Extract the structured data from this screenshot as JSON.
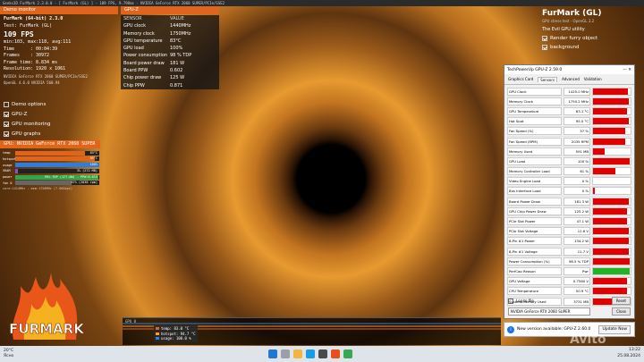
{
  "window_title": "Geeks3D FurMark 2.3.0.0 - [ FurMark (GL) ] - 109 FPS, 9.798ms - NVIDIA GeForce RTX 2060 SUPER/PCIe/SSE2",
  "demo_monitor": "Demo monitor",
  "info": {
    "app": "FurMark (64-bit) 2.3.0",
    "test": "Test: FurMark (GL)",
    "fps": "109 FPS",
    "minmax": "min:103, max:118, avg:111",
    "rows": [
      {
        "k": "Time",
        "v": ": 00:04:39"
      },
      {
        "k": "Frames",
        "v": ": 30972"
      },
      {
        "k": "Frame time",
        "v": ": 8.834 ms"
      },
      {
        "k": "Resolution",
        "v": ": 1920 x 1061"
      }
    ],
    "renderer": "NVIDIA GeForce RTX 2060 SUPER/PCIe/SSE2",
    "opengl": "OpenGL 4.6.0 NVIDIA 560.94"
  },
  "options": [
    {
      "label": "Demo options",
      "checked": false
    },
    {
      "label": "GPU-Z",
      "checked": true
    },
    {
      "label": "GPU monitoring",
      "checked": true
    },
    {
      "label": "GPU graphs",
      "checked": true
    }
  ],
  "gpu_panel": {
    "title": "GPU: NVIDIA GeForce RTX 2060 SUPER",
    "bars": [
      {
        "label": "temp",
        "value": "83°C",
        "fill": 0.83,
        "color": "#e0651a"
      },
      {
        "label": "hotspot",
        "value": "95°C",
        "fill": 0.95,
        "color": "#e0651a"
      },
      {
        "label": "usage",
        "value": "100%",
        "fill": 1.0,
        "color": "#2a7de1"
      },
      {
        "label": "VRAM",
        "value": "3% (272 MB)",
        "fill": 0.03,
        "color": "#8a4bd6"
      },
      {
        "label": "power",
        "value": "99% TDP (177.0W) - PPW:0.615",
        "fill": 0.99,
        "color": "#2aa84a"
      },
      {
        "label": "fan 0",
        "value": "67% (2038 rpm)",
        "fill": 0.67,
        "color": "#666666"
      }
    ],
    "core": "core:1424MHz - mem:1750MHz (7.00Gbps)"
  },
  "gpuz_overlay": {
    "title": "GPU-Z",
    "header": {
      "k": "SENSOR",
      "v": "VALUE"
    },
    "rows": [
      {
        "k": "GPU clock",
        "v": "1440MHz"
      },
      {
        "k": "Memory clock",
        "v": "1750MHz"
      },
      {
        "k": "GPU temperature",
        "v": "83°C"
      },
      {
        "k": "GPU load",
        "v": "100%"
      },
      {
        "k": "Power consumption",
        "v": "98 % TDP"
      },
      {
        "k": "Board power draw",
        "v": "181 W"
      },
      {
        "k": "Board PPW",
        "v": "0.602"
      },
      {
        "k": "Chip power draw",
        "v": "125 W"
      },
      {
        "k": "Chip PPW",
        "v": "0.871"
      }
    ]
  },
  "right_panel": {
    "title": "FurMark (GL)",
    "subtitle": "GPU stress test - OpenGL 3.2",
    "utility": "The Evil GPU utility",
    "options": [
      {
        "label": "Render furry object",
        "checked": true
      },
      {
        "label": "background",
        "checked": true
      }
    ]
  },
  "gpuz_window": {
    "title": "TechPowerUp GPU-Z 2.59.0",
    "tabs": [
      "Graphics Card",
      "Sensors",
      "Advanced",
      "Validation"
    ],
    "active_tab": "Sensors",
    "sensors": [
      {
        "name": "GPU Clock",
        "value": "1425.0 MHz",
        "fill": 0.92,
        "color": "#e00000"
      },
      {
        "name": "Memory Clock",
        "value": "1750.2 MHz",
        "fill": 0.95,
        "color": "#e00000"
      },
      {
        "name": "GPU Temperature",
        "value": "83.1 °C",
        "fill": 0.9,
        "color": "#e00000"
      },
      {
        "name": "Hot Spot",
        "value": "95.0 °C",
        "fill": 0.95,
        "color": "#e00000"
      },
      {
        "name": "Fan Speed (%)",
        "value": "57 %",
        "fill": 0.85,
        "color": "#e00000"
      },
      {
        "name": "Fan Speed (RPM)",
        "value": "2035 RPM",
        "fill": 0.85,
        "color": "#e00000"
      },
      {
        "name": "Memory Used",
        "value": "591 MB",
        "fill": 0.3,
        "color": "#e00000"
      },
      {
        "name": "GPU Load",
        "value": "100 %",
        "fill": 0.97,
        "color": "#e00000"
      },
      {
        "name": "Memory Controller Load",
        "value": "61 %",
        "fill": 0.6,
        "color": "#e00000"
      },
      {
        "name": "Video Engine Load",
        "value": "0 %",
        "fill": 0.0,
        "color": "#e00000"
      },
      {
        "name": "Bus Interface Load",
        "value": "0 %",
        "fill": 0.05,
        "color": "#e00000"
      },
      {
        "name": "Board Power Draw",
        "value": "181.3 W",
        "fill": 0.95,
        "color": "#e00000"
      },
      {
        "name": "GPU Chip Power Draw",
        "value": "125.2 W",
        "fill": 0.9,
        "color": "#e00000"
      },
      {
        "name": "PCIe Slot Power",
        "value": "47.1 W",
        "fill": 0.9,
        "color": "#e00000"
      },
      {
        "name": "PCIe Slot Voltage",
        "value": "11.6 V",
        "fill": 0.95,
        "color": "#e00000"
      },
      {
        "name": "8-Pin #1 Power",
        "value": "134.2 W",
        "fill": 0.95,
        "color": "#e00000"
      },
      {
        "name": "8-Pin #1 Voltage",
        "value": "11.7 V",
        "fill": 0.95,
        "color": "#e00000"
      },
      {
        "name": "Power Consumption (%)",
        "value": "98.5 % TDP",
        "fill": 0.97,
        "color": "#e00000"
      },
      {
        "name": "PerfCap Reason",
        "value": "Pwr",
        "fill": 0.97,
        "color": "#22b422"
      },
      {
        "name": "GPU Voltage",
        "value": "0.7560 V",
        "fill": 0.9,
        "color": "#e00000"
      },
      {
        "name": "CPU Temperature",
        "value": "50.9 °C",
        "fill": 0.9,
        "color": "#e00000"
      },
      {
        "name": "System Memory Used",
        "value": "3731 MB",
        "fill": 0.95,
        "color": "#e00000"
      }
    ],
    "log_label": "Log to file",
    "reset_label": "Reset",
    "device": "NVIDIA GeForce RTX 2060 SUPER",
    "close_label": "Close"
  },
  "toast": {
    "text": "New version available: GPU-Z 2.60.0",
    "button": "Update Now"
  },
  "gpu0_graph": {
    "label": "GPU 0",
    "legend": [
      {
        "text": "temp: 83.0 °C",
        "color": "#e0651a"
      },
      {
        "text": "hotspot: 94.7 °C",
        "color": "#ff9a2e"
      },
      {
        "text": "usage: 100.0 %",
        "color": "#2a7de1"
      }
    ]
  },
  "logo_text": "FURMARK",
  "watermark": "Avito",
  "weather": {
    "temp": "20°C",
    "desc": "Ясно"
  },
  "tray": {
    "time": "13:22",
    "date": "25.08.2024"
  }
}
